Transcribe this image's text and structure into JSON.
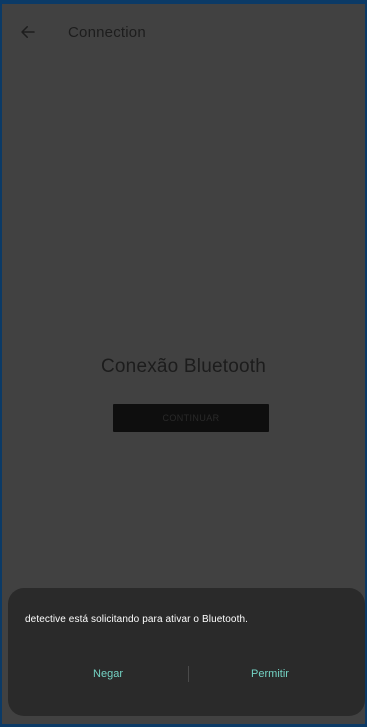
{
  "app_bar": {
    "back_icon": "arrow-left-icon",
    "title": "Connection"
  },
  "main": {
    "heading": "Conexão Bluetooth",
    "continue_label": "CONTINUAR"
  },
  "dialog": {
    "message": "detective está solicitando para ativar o Bluetooth.",
    "deny_label": "Negar",
    "allow_label": "Permitir",
    "accent_color": "#74d3c4"
  },
  "colors": {
    "frame": "#0b3a66",
    "scrim_background": "#414141",
    "sheet_background": "#2a2a2a"
  }
}
